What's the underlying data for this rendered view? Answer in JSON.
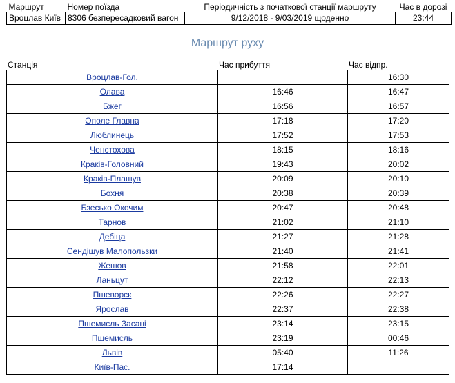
{
  "summary": {
    "headers": [
      "Маршрут",
      "Номер поїзда",
      "Періодичність з початкової станції маршруту",
      "Час в дорозі"
    ],
    "row": {
      "route": "Вроцлав Київ",
      "train": "8306 безпересадковий вагон",
      "periodicity": "9/12/2018 - 9/03/2019 щоденно",
      "travel_time": "23:44"
    }
  },
  "route_title": "Маршрут руху",
  "route_headers": {
    "station": "Станція",
    "arrival": "Час прибуття",
    "departure": "Час відпр."
  },
  "stops": [
    {
      "station": "Вроцлав-Гол.",
      "arrival": "",
      "departure": "16:30"
    },
    {
      "station": "Олава",
      "arrival": "16:46",
      "departure": "16:47"
    },
    {
      "station": "Бжег",
      "arrival": "16:56",
      "departure": "16:57"
    },
    {
      "station": "Ополе Главна",
      "arrival": "17:18",
      "departure": "17:20"
    },
    {
      "station": "Люблинець",
      "arrival": "17:52",
      "departure": "17:53"
    },
    {
      "station": "Ченстохова",
      "arrival": "18:15",
      "departure": "18:16"
    },
    {
      "station": "Краків-Головний",
      "arrival": "19:43",
      "departure": "20:02"
    },
    {
      "station": "Краків-Плашув",
      "arrival": "20:09",
      "departure": "20:10"
    },
    {
      "station": "Бохня",
      "arrival": "20:38",
      "departure": "20:39"
    },
    {
      "station": "Бзесько Окочим",
      "arrival": "20:47",
      "departure": "20:48"
    },
    {
      "station": "Тарнов",
      "arrival": "21:02",
      "departure": "21:10"
    },
    {
      "station": "Дебіца",
      "arrival": "21:27",
      "departure": "21:28"
    },
    {
      "station": "Сендішув Малопользки",
      "arrival": "21:40",
      "departure": "21:41"
    },
    {
      "station": "Жешов",
      "arrival": "21:58",
      "departure": "22:01"
    },
    {
      "station": "Ланьцут",
      "arrival": "22:12",
      "departure": "22:13"
    },
    {
      "station": "Пшеворск",
      "arrival": "22:26",
      "departure": "22:27"
    },
    {
      "station": "Ярослав",
      "arrival": "22:37",
      "departure": "22:38"
    },
    {
      "station": "Пшемисль Засані",
      "arrival": "23:14",
      "departure": "23:15"
    },
    {
      "station": "Пшемисль",
      "arrival": "23:19",
      "departure": "00:46"
    },
    {
      "station": "Львів",
      "arrival": "05:40",
      "departure": "11:26"
    },
    {
      "station": "Київ-Пас.",
      "arrival": "17:14",
      "departure": ""
    }
  ]
}
